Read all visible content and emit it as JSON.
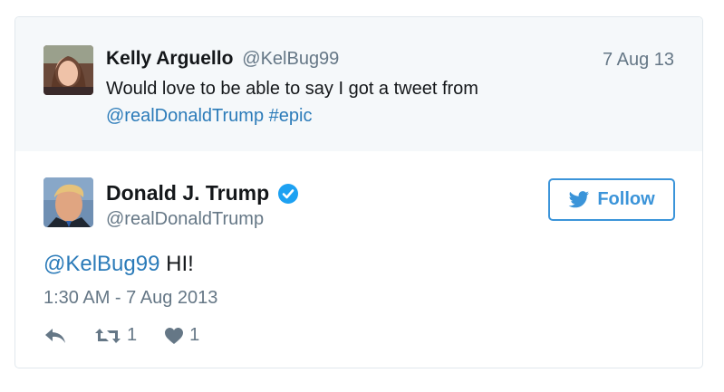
{
  "parent_tweet": {
    "name": "Kelly Arguello",
    "handle": "@KelBug99",
    "date": "7 Aug 13",
    "text": "Would love to be able to say I got a tweet from",
    "mention": "@realDonaldTrump",
    "hashtag": "#epic"
  },
  "main_tweet": {
    "name": "Donald J. Trump",
    "handle": "@realDonaldTrump",
    "follow_label": "Follow",
    "mention": "@KelBug99",
    "text": "HI!",
    "timestamp": "1:30 AM - 7 Aug 2013",
    "retweets": "1",
    "likes": "1"
  },
  "colors": {
    "link": "#2b7bb9",
    "follow": "#3b94d9",
    "muted": "#657786",
    "parent_bg": "#f5f8fa"
  },
  "icons": [
    "reply-icon",
    "retweet-icon",
    "heart-icon",
    "verified-icon",
    "twitter-bird-icon"
  ]
}
